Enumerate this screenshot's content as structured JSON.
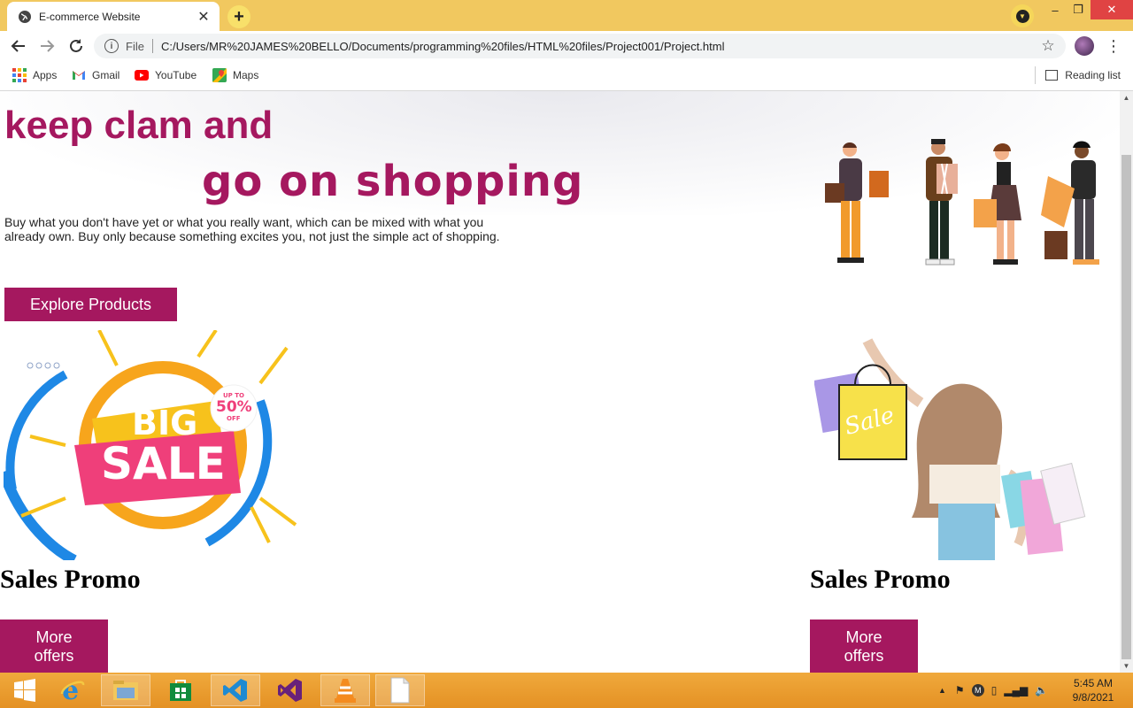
{
  "browser": {
    "tab_title": "E-commerce Website",
    "tab_close": "✕",
    "new_tab": "+",
    "window_buttons": {
      "minimize": "–",
      "maximize": "❐",
      "close": "✕"
    },
    "scheme_label": "File",
    "url": "C:/Users/MR%20JAMES%20BELLO/Documents/programming%20files/HTML%20files/Project001/Project.html",
    "bookmarks": [
      {
        "label": "Apps",
        "icon": "apps-grid-icon"
      },
      {
        "label": "Gmail",
        "icon": "gmail-icon"
      },
      {
        "label": "YouTube",
        "icon": "youtube-icon"
      },
      {
        "label": "Maps",
        "icon": "maps-icon"
      }
    ],
    "reading_list": "Reading list"
  },
  "page": {
    "headline_1": "keep clam and",
    "headline_2": "go on shopping",
    "description": "Buy what you don't have yet or what you really want, which can be mixed with what you already own. Buy only because something excites you, not just the simple act of shopping.",
    "explore_button": "Explore Products",
    "banner_text_1": "BIG",
    "banner_text_2": "SALE",
    "badge_line_1": "UP TO",
    "badge_line_2": "50%",
    "badge_line_3": "OFF",
    "bag_text": "Sale",
    "promos": [
      {
        "title": "Sales Promo",
        "button_line_1": "More",
        "button_line_2": "offers"
      },
      {
        "title": "Sales Promo",
        "button_line_1": "More",
        "button_line_2": "offers"
      }
    ]
  },
  "taskbar": {
    "apps": [
      "windows-start-icon",
      "internet-explorer-icon",
      "file-explorer-icon",
      "store-icon",
      "vscode-icon",
      "visual-studio-icon",
      "vlc-icon",
      "notepad-icon"
    ],
    "time": "5:45 AM",
    "date": "9/8/2021"
  },
  "colors": {
    "accent": "#a5185f",
    "tab_bar": "#f1c85f",
    "taskbar": "#e8992b"
  }
}
